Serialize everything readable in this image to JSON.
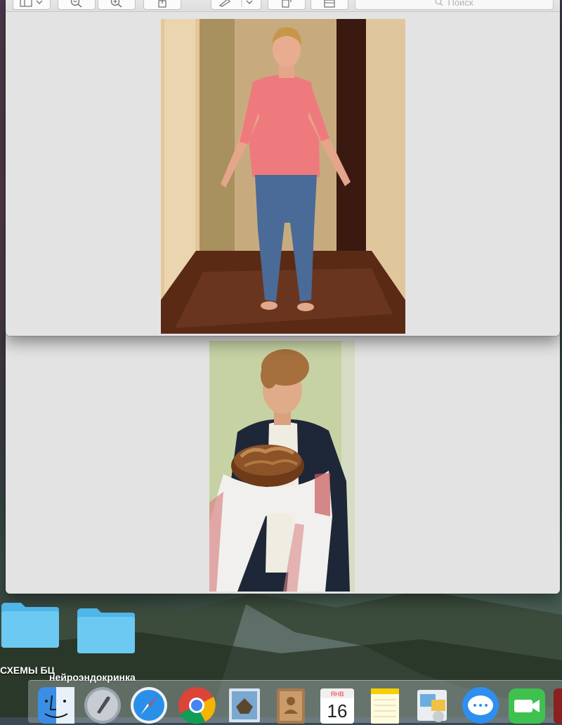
{
  "toolbar": {
    "search_placeholder": "Поиск",
    "buttons": [
      "sidebar-view",
      "zoom-out",
      "zoom-in",
      "share",
      "markup",
      "rotate",
      "toolbox"
    ]
  },
  "desktop": {
    "folders": [
      {
        "label": "СХЕМЫ БЦ"
      },
      {
        "label": "нейроэндокринка"
      }
    ]
  },
  "dock": {
    "items": [
      "Finder",
      "Launchpad",
      "Safari",
      "Chrome",
      "Mail",
      "Contacts",
      "Calendar",
      "Notes",
      "Photos",
      "Messages",
      "FaceTime"
    ],
    "calendar": {
      "month": "ЯНВ",
      "day": "16"
    }
  },
  "colors": {
    "window_bg": "#e3e3e3",
    "folder": "#5fc3f0",
    "shirt": "#f07e82",
    "jeans": "#4a6a98"
  }
}
